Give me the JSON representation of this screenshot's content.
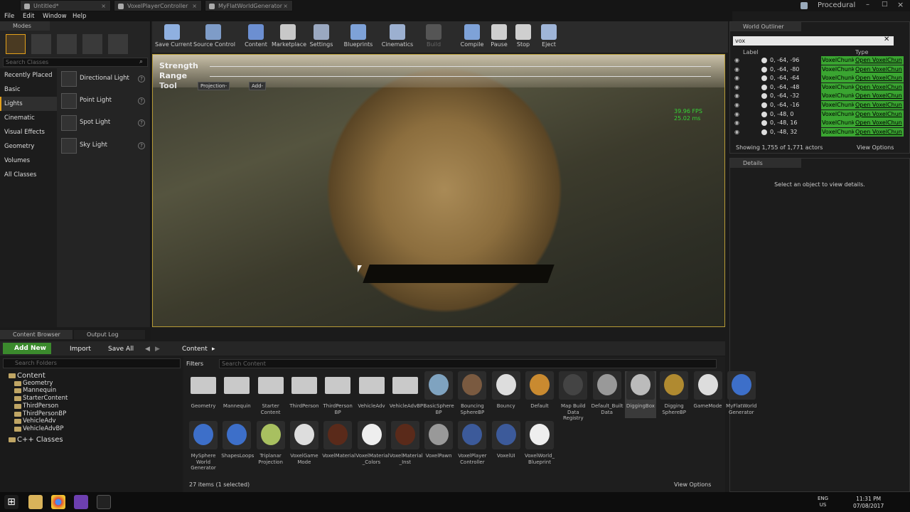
{
  "window": {
    "tabs": [
      "Untitled*",
      "VoxelPlayerController",
      "MyFlatWorldGenerator"
    ],
    "app_label": "Procedural"
  },
  "menu": [
    "File",
    "Edit",
    "Window",
    "Help"
  ],
  "modes": {
    "title": "Modes",
    "search_placeholder": "Search Classes",
    "categories": [
      "Recently Placed",
      "Basic",
      "Lights",
      "Cinematic",
      "Visual Effects",
      "Geometry",
      "Volumes",
      "All Classes"
    ],
    "lights": [
      "Directional Light",
      "Point Light",
      "Spot Light",
      "Sky Light"
    ]
  },
  "toolbar": [
    {
      "label": "Save Current",
      "color": "#8fb0e0"
    },
    {
      "label": "Source Control",
      "color": "#7e9cc8"
    },
    {
      "label": "Content",
      "color": "#6c8fd1"
    },
    {
      "label": "Marketplace",
      "color": "#c8c8c8"
    },
    {
      "label": "Settings",
      "color": "#9aa8c0"
    },
    {
      "label": "Blueprints",
      "color": "#7ea2d8"
    },
    {
      "label": "Cinematics",
      "color": "#9cb0d0"
    },
    {
      "label": "Build",
      "color": "#555"
    },
    {
      "label": "Compile",
      "color": "#7ea2d8"
    },
    {
      "label": "Pause",
      "color": "#cfcfcf"
    },
    {
      "label": "Stop",
      "color": "#cfcfcf"
    },
    {
      "label": "Eject",
      "color": "#9fb5d8"
    }
  ],
  "viewport": {
    "strength": "Strength",
    "range": "Range",
    "tool": "Tool",
    "projection_btn": "Projection-",
    "add_btn": "Add-",
    "fps": "39.96 FPS",
    "ms": "25.02 ms"
  },
  "outliner": {
    "title": "World Outliner",
    "search": "vox",
    "col_label": "Label",
    "col_type": "Type",
    "rows": [
      {
        "label": "0, -64, -96",
        "type": "VoxelChunk",
        "open": "Open VoxelChun"
      },
      {
        "label": "0, -64, -80",
        "type": "VoxelChunk",
        "open": "Open VoxelChun"
      },
      {
        "label": "0, -64, -64",
        "type": "VoxelChunk",
        "open": "Open VoxelChun"
      },
      {
        "label": "0, -64, -48",
        "type": "VoxelChunk",
        "open": "Open VoxelChun"
      },
      {
        "label": "0, -64, -32",
        "type": "VoxelChunk",
        "open": "Open VoxelChun"
      },
      {
        "label": "0, -64, -16",
        "type": "VoxelChunk",
        "open": "Open VoxelChun"
      },
      {
        "label": "0, -48, 0",
        "type": "VoxelChunk",
        "open": "Open VoxelChun"
      },
      {
        "label": "0, -48, 16",
        "type": "VoxelChunk",
        "open": "Open VoxelChun"
      },
      {
        "label": "0, -48, 32",
        "type": "VoxelChunk",
        "open": "Open VoxelChun"
      }
    ],
    "status": "Showing 1,755 of 1,771 actors",
    "view_options": "View Options"
  },
  "details": {
    "title": "Details",
    "empty": "Select an object to view details."
  },
  "content_browser": {
    "tabs": [
      "Content Browser",
      "Output Log"
    ],
    "add_new": "Add New",
    "import": "Import",
    "save_all": "Save All",
    "path": "Content",
    "folder_search": "Search Folders",
    "filters": "Filters",
    "asset_search": "Search Content",
    "tree": [
      {
        "name": "Content",
        "level": 0
      },
      {
        "name": "Geometry",
        "level": 1
      },
      {
        "name": "Mannequin",
        "level": 1
      },
      {
        "name": "StarterContent",
        "level": 1
      },
      {
        "name": "ThirdPerson",
        "level": 1
      },
      {
        "name": "ThirdPersonBP",
        "level": 1
      },
      {
        "name": "VehicleAdv",
        "level": 1
      },
      {
        "name": "VehicleAdvBP",
        "level": 1
      },
      {
        "name": "C++ Classes",
        "level": 0
      }
    ],
    "assets": [
      {
        "name": "Geometry",
        "color": "#c9c9c9"
      },
      {
        "name": "Mannequin",
        "color": "#c9c9c9"
      },
      {
        "name": "Starter Content",
        "color": "#c9c9c9"
      },
      {
        "name": "ThirdPerson",
        "color": "#c9c9c9"
      },
      {
        "name": "ThirdPerson BP",
        "color": "#c9c9c9"
      },
      {
        "name": "VehicleAdv",
        "color": "#c9c9c9"
      },
      {
        "name": "VehicleAdvBP",
        "color": "#c9c9c9"
      },
      {
        "name": "BasicSphere BP",
        "color": "#7fa3c0"
      },
      {
        "name": "Bouncing SphereBP",
        "color": "#7a5a40"
      },
      {
        "name": "Bouncy",
        "color": "#dddddd"
      },
      {
        "name": "Default",
        "color": "#c98a30"
      },
      {
        "name": "Map Build Data Registry",
        "color": "#444444"
      },
      {
        "name": "Default_Built Data",
        "color": "#999999"
      },
      {
        "name": "DiggingBox",
        "color": "#bbbbbb"
      },
      {
        "name": "Digging SphereBP",
        "color": "#b08a30"
      },
      {
        "name": "GameMode",
        "color": "#dddddd"
      },
      {
        "name": "MyFlatWorld Generator",
        "color": "#3d6fc9"
      },
      {
        "name": "MySphere World Generator",
        "color": "#3d6fc9"
      },
      {
        "name": "ShapesLoops",
        "color": "#3d6fc9"
      },
      {
        "name": "Triplanar Projection",
        "color": "#a8c060"
      },
      {
        "name": "VoxelGame Mode",
        "color": "#dddddd"
      },
      {
        "name": "VoxelMaterial",
        "color": "#5a2a1a"
      },
      {
        "name": "VoxelMaterial _Colors",
        "color": "#eeeeee"
      },
      {
        "name": "VoxelMaterial _Inst",
        "color": "#5a2a1a"
      },
      {
        "name": "VoxelPawn",
        "color": "#999999"
      },
      {
        "name": "VoxelPlayer Controller",
        "color": "#3c5a9a"
      },
      {
        "name": "VoxelUI",
        "color": "#3c5a9a"
      },
      {
        "name": "VoxelWorld_ Blueprint",
        "color": "#eeeeee"
      }
    ],
    "status": "27 items (1 selected)",
    "view_options": "View Options"
  },
  "taskbar": {
    "lang": "ENG",
    "region": "US",
    "time": "11:31 PM",
    "date": "07/08/2017"
  }
}
